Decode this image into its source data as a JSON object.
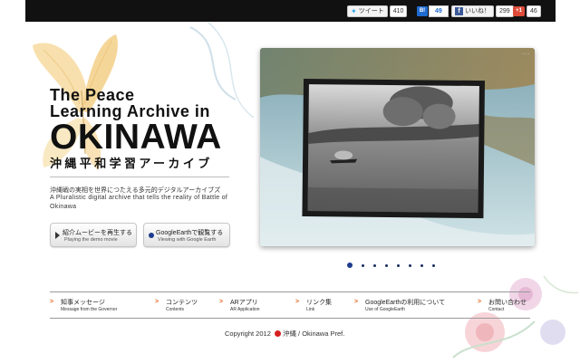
{
  "social": {
    "tweet_label": "ツイート",
    "tweet_count": "410",
    "hatena_label": "B!",
    "hatena_count": "49",
    "like_label": "いいね！",
    "like_count": "299",
    "gplus_label": "+1",
    "gplus_count": "46"
  },
  "brand": {
    "line1": "The Peace",
    "line2": "Learning Archive in",
    "line3": "OKINAWA",
    "line4": "沖縄平和学習アーカイブ"
  },
  "tagline": {
    "jp": "沖縄戦の実相を世界につたえる多元的デジタルアーカイブズ",
    "en": "A Pluralistic digital archive that tells the reality of Battle of Okinawa"
  },
  "cta": {
    "demo_jp": "紹介ムービーを再生する",
    "demo_en": "Playing the demo movie",
    "ge_jp": "GoogleEarthで観覧する",
    "ge_en": "Viewing with Google Earth"
  },
  "slider": {
    "pages": 8,
    "active_index": 0
  },
  "nav": [
    {
      "jp": "知事メッセージ",
      "en": "Message from the Governor"
    },
    {
      "jp": "コンテンツ",
      "en": "Contents"
    },
    {
      "jp": "ARアプリ",
      "en": "AR Application"
    },
    {
      "jp": "リンク集",
      "en": "Link"
    },
    {
      "jp": "GoogleEarthの利用について",
      "en": "Use of GoogleEarth"
    },
    {
      "jp": "お問い合わせ",
      "en": "Contact"
    }
  ],
  "footer": {
    "copyright_prefix": "Copyright 2012",
    "copyright_org": "沖縄 / Okinawa Pref."
  },
  "colors": {
    "topbar": "#111111",
    "accent_orange": "#e5621c",
    "dot_blue": "#1f3b8f"
  },
  "icons": [
    "tweet-icon",
    "hatena-icon",
    "facebook-icon",
    "gplus-icon",
    "play-icon",
    "globe-dot-icon",
    "nav-arrow-icon",
    "okinawa-mark-icon"
  ]
}
